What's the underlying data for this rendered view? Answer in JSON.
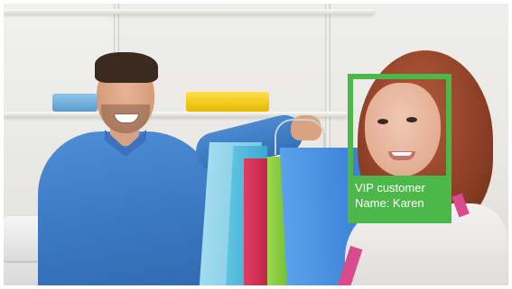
{
  "recognition": {
    "frame_color": "#4cb84a",
    "label_text_color": "#ffffff",
    "tag": "VIP customer",
    "name_line": "Name: Karen"
  },
  "scene": {
    "icon": "camera-feed-icon",
    "bag_colors": [
      "#8fd3e8",
      "#5ec2e0",
      "#d62f55",
      "#8fcf43",
      "#3f8ce0"
    ]
  }
}
